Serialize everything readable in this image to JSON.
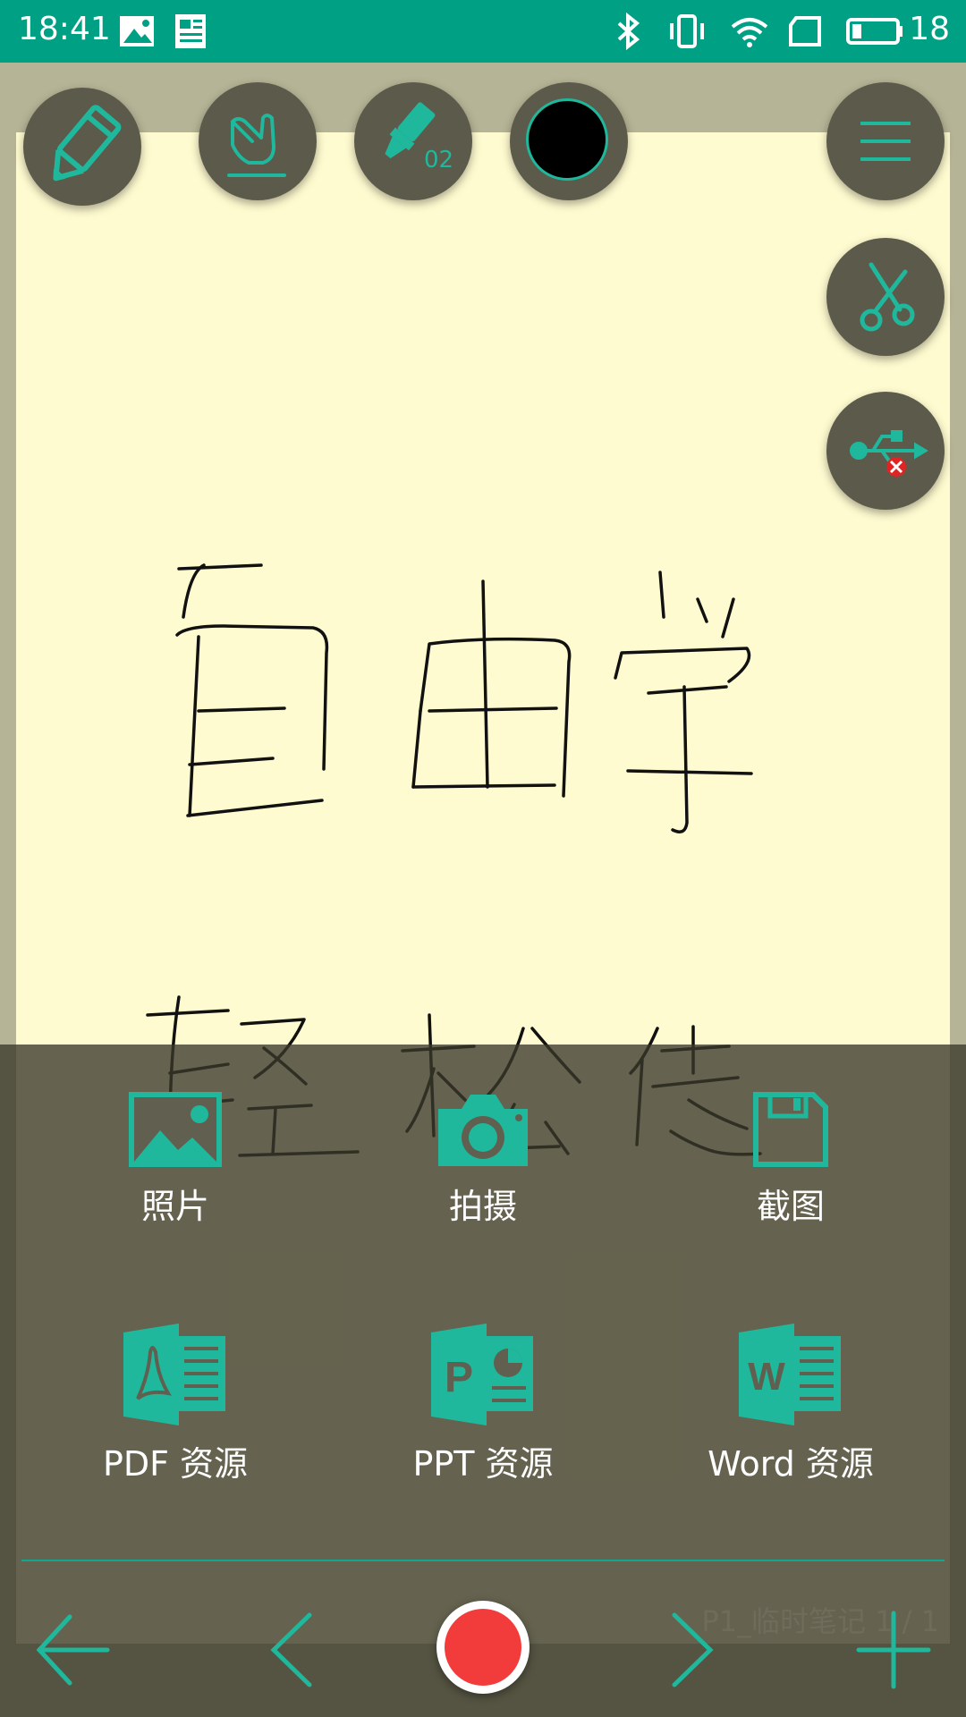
{
  "status_bar": {
    "time": "18:41",
    "battery": "18",
    "icons": [
      "image-icon",
      "news-icon",
      "bluetooth-icon",
      "vibrate-icon",
      "wifi-icon",
      "sim-icon",
      "battery-icon"
    ]
  },
  "toolbar": {
    "pen_tool": "pencil-icon",
    "hand_tool": "hand-pointer-icon",
    "marker_size": "02",
    "color_swatch": "#000000",
    "menu": "menu-icon",
    "scissors": "scissors-icon",
    "usb": "usb-disconnected-icon"
  },
  "insert_menu": {
    "row1": [
      {
        "label": "照片",
        "icon": "photo-icon"
      },
      {
        "label": "拍摄",
        "icon": "camera-icon"
      },
      {
        "label": "截图",
        "icon": "save-disk-icon"
      }
    ],
    "row2": [
      {
        "label": "PDF 资源",
        "icon": "pdf-file-icon",
        "badge": ""
      },
      {
        "label": "PPT 资源",
        "icon": "ppt-file-icon",
        "badge": "P"
      },
      {
        "label": "Word 资源",
        "icon": "word-file-icon",
        "badge": "W"
      }
    ]
  },
  "footer": {
    "page_label": "P1_临时笔记  1 / 1"
  },
  "colors": {
    "accent": "#1fb89c",
    "status_bar": "#00a085",
    "paper": "#fffbd0",
    "record": "#f23c3c"
  }
}
